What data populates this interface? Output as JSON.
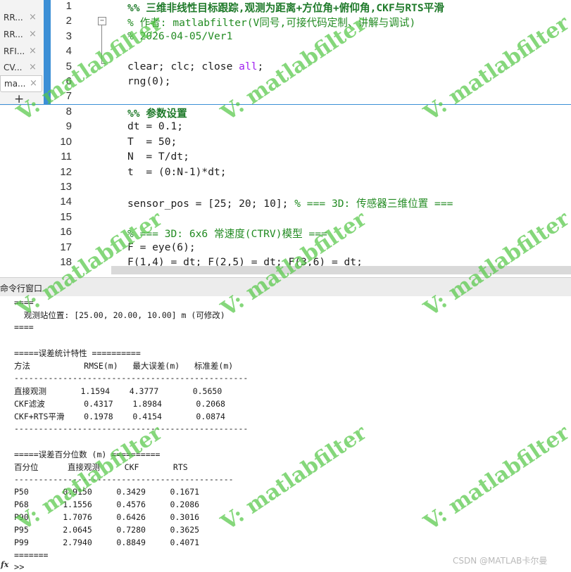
{
  "colors": {
    "accent": "#3c8fd6",
    "comment": "#228b22",
    "keyword": "#a020f0",
    "watermark": "#56c848"
  },
  "file_tabs": [
    {
      "label": "RR...",
      "close": "×"
    },
    {
      "label": "RR...",
      "close": "×"
    },
    {
      "label": "RFI...",
      "close": "×"
    },
    {
      "label": "CV...",
      "close": "×"
    },
    {
      "label": "ma...",
      "close": "×"
    }
  ],
  "add_tab": "+",
  "fold_glyph": "−",
  "line_numbers": [
    "1",
    "2",
    "3",
    "4",
    "5",
    "6",
    "7",
    "8",
    "9",
    "10",
    "11",
    "12",
    "13",
    "14",
    "15",
    "16",
    "17",
    "18"
  ],
  "code": {
    "l1": "%% 三维非线性目标跟踪,观测为距离+方位角+俯仰角,CKF与RTS平滑",
    "l2": "% 作者: matlabfilter(V同号,可接代码定制、讲解与调试)",
    "l3": "% 2026-04-05/Ver1",
    "l5_pre": "clear; clc; close ",
    "l5_kw": "all",
    "l5_post": ";",
    "l6": "rng(0);",
    "l8": "%% 参数设置",
    "l9": "dt = 0.1;",
    "l10": "T  = 50;",
    "l11": "N  = T/dt;",
    "l12": "t  = (0:N-1)*dt;",
    "l14_pre": "sensor_pos = [25; 20; 10]; ",
    "l14_cm": "% === 3D: 传感器三维位置 ===",
    "l16": "% === 3D: 6x6 常速度(CTRV)模型 ===",
    "l17": "F = eye(6);",
    "l18": "F(1,4) = dt; F(2,5) = dt; F(3,6) = dt;"
  },
  "command_window": {
    "title": "命令行窗口",
    "lines": [
      "====",
      "  观测站位置: [25.00, 20.00, 10.00] m (可修改)",
      "====",
      "=====误差统计特性 ==========",
      "方法           RMSE(m)   最大误差(m)   标准差(m)",
      "------------------------------------------------",
      "直接观测       1.1594    4.3777       0.5650",
      "CKF滤波        0.4317    1.8984       0.2068",
      "CKF+RTS平滑    0.1978    0.4154       0.0874",
      "------------------------------------------------",
      "=====误差百分位数 (m) ==========",
      "百分位      直接观测     CKF       RTS",
      "---------------------------------------------",
      "P50       0.9150     0.3429     0.1671",
      "P68       1.1556     0.4576     0.2086",
      "P90       1.7076     0.6426     0.3016",
      "P95       2.0645     0.7280     0.3625",
      "P99       2.7940     0.8849     0.4071",
      "======="
    ],
    "fx_label": "fx",
    "prompt": ">>"
  },
  "watermark_text": "V: matlabfilter",
  "credit": "CSDN @MATLAB卡尔曼"
}
